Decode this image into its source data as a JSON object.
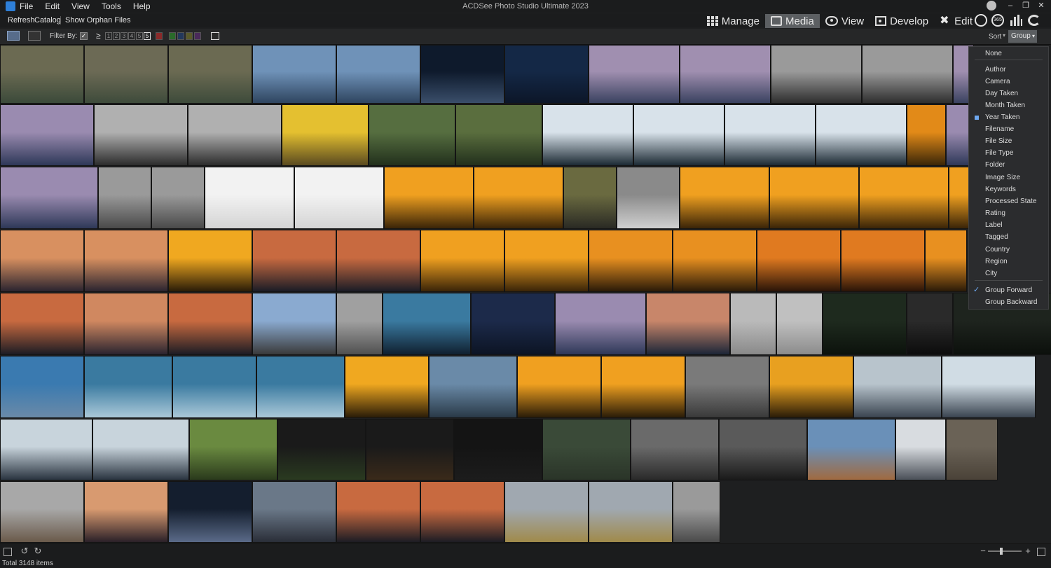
{
  "window": {
    "title": "ACDSee Photo Studio Ultimate 2023"
  },
  "menu": [
    "File",
    "Edit",
    "View",
    "Tools",
    "Help"
  ],
  "toolbar": {
    "refresh": "Refresh",
    "catalog": "Catalog",
    "show_orphan": "Show Orphan Files"
  },
  "modes": [
    {
      "label": "Manage",
      "icon": "grid-icon",
      "active": false
    },
    {
      "label": "Media",
      "icon": "media-icon",
      "active": true
    },
    {
      "label": "View",
      "icon": "eye-icon",
      "active": false
    },
    {
      "label": "Develop",
      "icon": "develop-icon",
      "active": false
    },
    {
      "label": "Edit",
      "icon": "edit-icon",
      "active": false
    }
  ],
  "extra_icons": {
    "badge_365": "365"
  },
  "filterbar": {
    "filter_by": "Filter By:",
    "ge": "≥",
    "rating_boxes": [
      "1",
      "2",
      "3",
      "4",
      "5"
    ],
    "selected_rating": "5",
    "color_labels": [
      "#8a2a2a",
      "#2a6a2a",
      "#23385c",
      "#5a5a2a",
      "#4a2a5a"
    ],
    "sort": "Sort",
    "group": "Group"
  },
  "group_menu": {
    "items": [
      {
        "label": "None",
        "state": ""
      },
      {
        "label": "Author",
        "state": ""
      },
      {
        "label": "Camera",
        "state": ""
      },
      {
        "label": "Day Taken",
        "state": ""
      },
      {
        "label": "Month Taken",
        "state": ""
      },
      {
        "label": "Year Taken",
        "state": "bullet"
      },
      {
        "label": "Filename",
        "state": ""
      },
      {
        "label": "File Size",
        "state": ""
      },
      {
        "label": "File Type",
        "state": ""
      },
      {
        "label": "Folder",
        "state": ""
      },
      {
        "label": "Image Size",
        "state": ""
      },
      {
        "label": "Keywords",
        "state": ""
      },
      {
        "label": "Processed State",
        "state": ""
      },
      {
        "label": "Rating",
        "state": ""
      },
      {
        "label": "Label",
        "state": ""
      },
      {
        "label": "Tagged",
        "state": ""
      },
      {
        "label": "Country",
        "state": ""
      },
      {
        "label": "Region",
        "state": ""
      },
      {
        "label": "City",
        "state": ""
      },
      {
        "label": "Group Forward",
        "state": "checked"
      },
      {
        "label": "Group Backward",
        "state": ""
      }
    ]
  },
  "status": {
    "total": "Total 3148 items"
  },
  "zoom": {
    "level": 0.4
  },
  "thumbnails": [
    {
      "row": 0,
      "widths": [
        120,
        120,
        120,
        120,
        120,
        120,
        120,
        130,
        130,
        130,
        130,
        30
      ],
      "colors": [
        [
          "#6b6a52",
          "#3b4a3a"
        ],
        [
          "#6c6a55",
          "#3e4b3b"
        ],
        [
          "#6b6a52",
          "#3e4b3b"
        ],
        [
          "#6f92b8",
          "#2f4560"
        ],
        [
          "#6f92b8",
          "#2f4560"
        ],
        [
          "#0e1a2c",
          "#3a4e6a"
        ],
        [
          "#142846",
          "#0c1628"
        ],
        [
          "#a08fb0",
          "#3a4260"
        ],
        [
          "#a08fb0",
          "#3a4260"
        ],
        [
          "#9a9a9a",
          "#2e2e2e"
        ],
        [
          "#9a9a9a",
          "#2e2e2e"
        ],
        [
          "#a08fb0",
          "#3a4260"
        ]
      ]
    },
    {
      "row": 1,
      "widths": [
        134,
        134,
        134,
        124,
        124,
        124,
        130,
        130,
        130,
        130,
        56,
        36
      ],
      "colors": [
        [
          "#9a8bb0",
          "#2e3858"
        ],
        [
          "#b0b0b0",
          "#2c2c2c"
        ],
        [
          "#b0b0b0",
          "#2c2c2c"
        ],
        [
          "#e4c030",
          "#5a4a20"
        ],
        [
          "#566e40",
          "#22301c"
        ],
        [
          "#5a6e3e",
          "#22301c"
        ],
        [
          "#d8e2ea",
          "#1c2a34"
        ],
        [
          "#d8e2ea",
          "#1c2a34"
        ],
        [
          "#d8e2ea",
          "#1c2a34"
        ],
        [
          "#d8e2ea",
          "#1c2a34"
        ],
        [
          "#e28a18",
          "#3a2608"
        ],
        [
          "#9a8bb0",
          "#2e3858"
        ]
      ]
    },
    {
      "row": 2,
      "widths": [
        140,
        76,
        76,
        128,
        128,
        128,
        128,
        76,
        90,
        128,
        128,
        128,
        30
      ],
      "colors": [
        [
          "#9a8bb0",
          "#2e3858"
        ],
        [
          "#9a9a9a",
          "#4a4a4a"
        ],
        [
          "#9a9a9a",
          "#4a4a4a"
        ],
        [
          "#f2f2f2",
          "#d4d4d4"
        ],
        [
          "#f2f2f2",
          "#d4d4d4"
        ],
        [
          "#f0a020",
          "#3a2408"
        ],
        [
          "#f0a020",
          "#3a2408"
        ],
        [
          "#6a6a40",
          "#2a2a24"
        ],
        [
          "#8a8a8a",
          "#d0d0d0"
        ],
        [
          "#f0a020",
          "#3a2408"
        ],
        [
          "#f0a020",
          "#3a2408"
        ],
        [
          "#f0a020",
          "#3a2408"
        ],
        [
          "#f0a020",
          "#3a2408"
        ]
      ]
    },
    {
      "row": 3,
      "widths": [
        120,
        120,
        120,
        120,
        120,
        120,
        120,
        120,
        120,
        120,
        120,
        60
      ],
      "colors": [
        [
          "#d89060",
          "#2a2430"
        ],
        [
          "#d89060",
          "#2a2430"
        ],
        [
          "#f0a820",
          "#2a1c08"
        ],
        [
          "#c86a40",
          "#1a1c26"
        ],
        [
          "#c86a40",
          "#1a1c26"
        ],
        [
          "#f0a020",
          "#3a2408"
        ],
        [
          "#f0a020",
          "#3a2408"
        ],
        [
          "#e89020",
          "#2a1a08"
        ],
        [
          "#e89020",
          "#2a1a08"
        ],
        [
          "#e07a20",
          "#2a1408"
        ],
        [
          "#e07a20",
          "#2a1408"
        ],
        [
          "#e89020",
          "#2a1a08"
        ]
      ]
    },
    {
      "row": 4,
      "widths": [
        120,
        120,
        120,
        120,
        66,
        126,
        120,
        130,
        120,
        66,
        66,
        120,
        66,
        180
      ],
      "colors": [
        [
          "#c86a40",
          "#1c1c24"
        ],
        [
          "#d08860",
          "#2a2430"
        ],
        [
          "#c86a40",
          "#1c1c24"
        ],
        [
          "#8aaad0",
          "#3a3a3a"
        ],
        [
          "#a0a0a0",
          "#505050"
        ],
        [
          "#3a7aa0",
          "#102030"
        ],
        [
          "#1c2a4a",
          "#0c1424"
        ],
        [
          "#9a8bb0",
          "#2e3858"
        ],
        [
          "#c8866a",
          "#1c2638"
        ],
        [
          "#bababa",
          "#8a8a8a"
        ],
        [
          "#c0c0c0",
          "#8c8c8c"
        ],
        [
          "#1e2a1e",
          "#0c120c"
        ],
        [
          "#2a2a2a",
          "#0c0c0c"
        ],
        [
          "#1e241e",
          "#0c100c"
        ]
      ]
    },
    {
      "row": 5,
      "widths": [
        120,
        126,
        120,
        126,
        120,
        126,
        120,
        120,
        120,
        120,
        126,
        134
      ],
      "colors": [
        [
          "#3a7ab0",
          "#6a8aa8"
        ],
        [
          "#3a7aa0",
          "#aac8d8"
        ],
        [
          "#3a7aa0",
          "#aac8d8"
        ],
        [
          "#3a7aa0",
          "#aac8d8"
        ],
        [
          "#f0a820",
          "#2a1c08"
        ],
        [
          "#6a8aa8",
          "#2a3a48"
        ],
        [
          "#f0a020",
          "#2a1c08"
        ],
        [
          "#f0a020",
          "#2a1c08"
        ],
        [
          "#7a7a7a",
          "#3a3a3a"
        ],
        [
          "#e8a020",
          "#2a1c08"
        ],
        [
          "#b8c4cc",
          "#3a4450"
        ],
        [
          "#d0dce4",
          "#3a4450"
        ]
      ]
    },
    {
      "row": 6,
      "widths": [
        132,
        138,
        126,
        126,
        126,
        126,
        126,
        126,
        126,
        126,
        72,
        74
      ],
      "colors": [
        [
          "#c8d4dc",
          "#2a3440"
        ],
        [
          "#c8d4dc",
          "#2a3440"
        ],
        [
          "#6a8a40",
          "#2a3a1c"
        ],
        [
          "#1a1a1a",
          "#2a3a20"
        ],
        [
          "#1a1a1a",
          "#3a2a1a"
        ],
        [
          "#141414",
          "#1c1c1c"
        ],
        [
          "#3a4a38",
          "#2a3428"
        ],
        [
          "#6a6a6a",
          "#2a2a2a"
        ],
        [
          "#5a5a5a",
          "#1a1a1a"
        ],
        [
          "#6a90b8",
          "#a06a40"
        ],
        [
          "#d8dce0",
          "#4a5058"
        ],
        [
          "#6a6256",
          "#4a4238"
        ]
      ]
    },
    {
      "row": 7,
      "widths": [
        120,
        120,
        120,
        120,
        120,
        120,
        120,
        120,
        68
      ],
      "colors": [
        [
          "#a8a8a8",
          "#6a5a4a"
        ],
        [
          "#d89a70",
          "#2a2028"
        ],
        [
          "#141e2e",
          "#5a6a88"
        ],
        [
          "#6a7888",
          "#2a2e38"
        ],
        [
          "#c86a40",
          "#1c1c24"
        ],
        [
          "#c86a40",
          "#1c1c24"
        ],
        [
          "#a0a8b0",
          "#a08a4a"
        ],
        [
          "#a0a8b0",
          "#a08a4a"
        ],
        [
          "#9a9a9a",
          "#4a4a4a"
        ]
      ]
    }
  ]
}
